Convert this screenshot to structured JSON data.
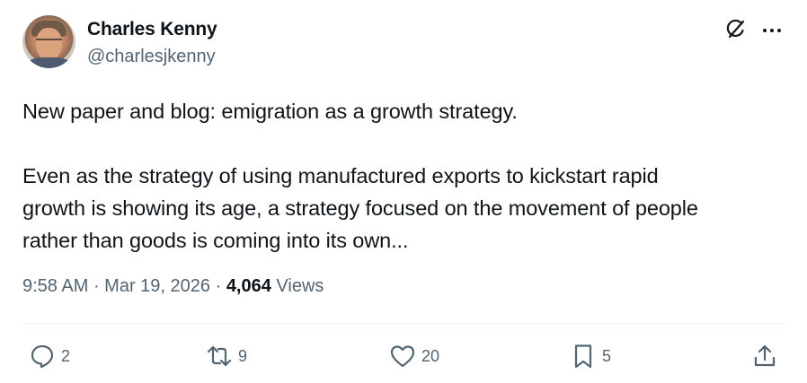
{
  "author": {
    "name": "Charles Kenny",
    "handle": "@charlesjkenny"
  },
  "icons": {
    "header_right": [
      "grok-icon",
      "more-icon"
    ],
    "actions": [
      "reply-icon",
      "retweet-icon",
      "like-icon",
      "bookmark-icon",
      "share-icon"
    ]
  },
  "tweet": {
    "paragraph1": "New paper and blog: emigration as a growth strategy.",
    "paragraph2_lines": [
      "Even as the strategy of using manufactured exports to kickstart rapid",
      "growth is showing its age, a strategy focused on the movement of people",
      "rather than goods is coming into its own..."
    ]
  },
  "meta": {
    "time": "9:58 AM",
    "sep1": " · ",
    "date": "Mar 19, 2026",
    "sep2": " · ",
    "views_count": "4,064",
    "views_label": " Views"
  },
  "actions": {
    "replies": "2",
    "retweets": "9",
    "likes": "20",
    "bookmarks": "5"
  },
  "colors": {
    "text_primary": "#0f1419",
    "text_secondary": "#536471",
    "divider": "#eff3f4"
  }
}
